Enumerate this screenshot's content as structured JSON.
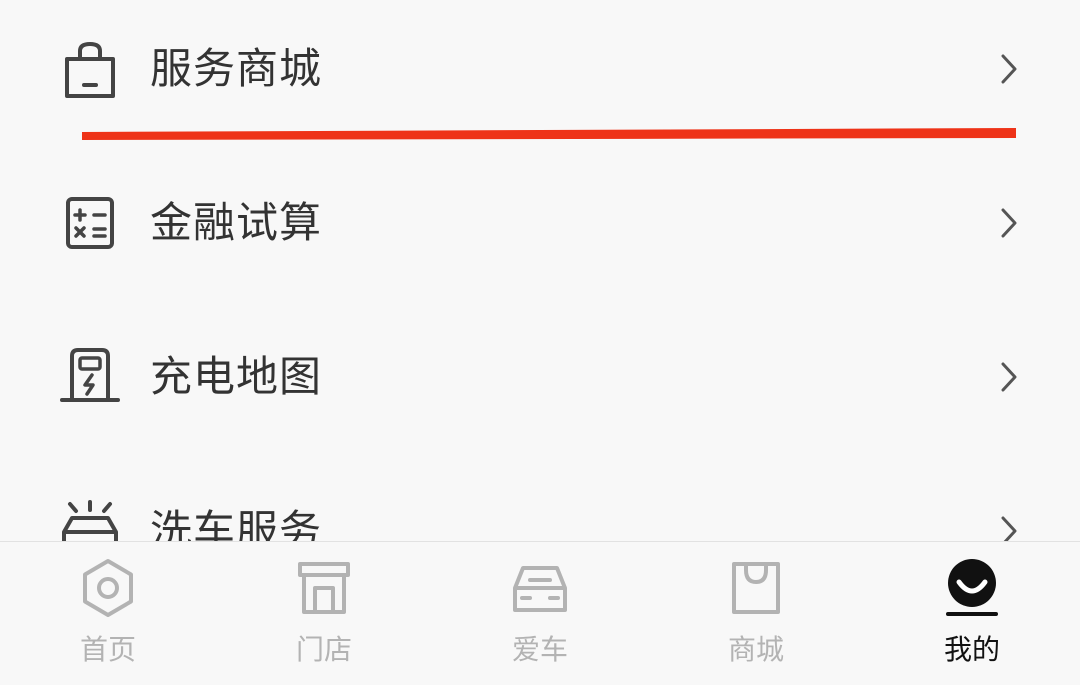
{
  "menu": {
    "items": [
      {
        "label": "服务商城",
        "icon": "shopping-bag-icon"
      },
      {
        "label": "金融试算",
        "icon": "calculator-icon"
      },
      {
        "label": "充电地图",
        "icon": "charging-station-icon"
      },
      {
        "label": "洗车服务",
        "icon": "car-wash-icon"
      }
    ],
    "chevron_icon": "chevron-right-icon"
  },
  "annotation": {
    "color": "#ee3318"
  },
  "tabbar": {
    "tabs": [
      {
        "label": "首页",
        "icon": "home-hexagon-icon",
        "active": false
      },
      {
        "label": "门店",
        "icon": "store-icon",
        "active": false
      },
      {
        "label": "爱车",
        "icon": "car-icon",
        "active": false
      },
      {
        "label": "商城",
        "icon": "shopping-bag-icon",
        "active": false
      },
      {
        "label": "我的",
        "icon": "profile-smile-icon",
        "active": true
      }
    ],
    "active_color": "#111111",
    "inactive_color": "#b3b3b3"
  }
}
